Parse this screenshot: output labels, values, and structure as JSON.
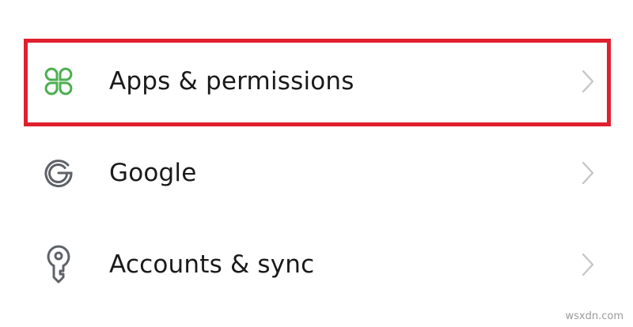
{
  "settings": {
    "items": [
      {
        "label": "Apps & permissions",
        "icon": "apps-grid-icon",
        "icon_color": "#4caf50",
        "highlighted": true
      },
      {
        "label": "Google",
        "icon": "google-g-icon",
        "icon_color": "#5f6368",
        "highlighted": false
      },
      {
        "label": "Accounts & sync",
        "icon": "key-icon",
        "icon_color": "#5f6368",
        "highlighted": false
      }
    ]
  },
  "highlight_color": "#e0202e",
  "watermark": "wsxdn.com"
}
